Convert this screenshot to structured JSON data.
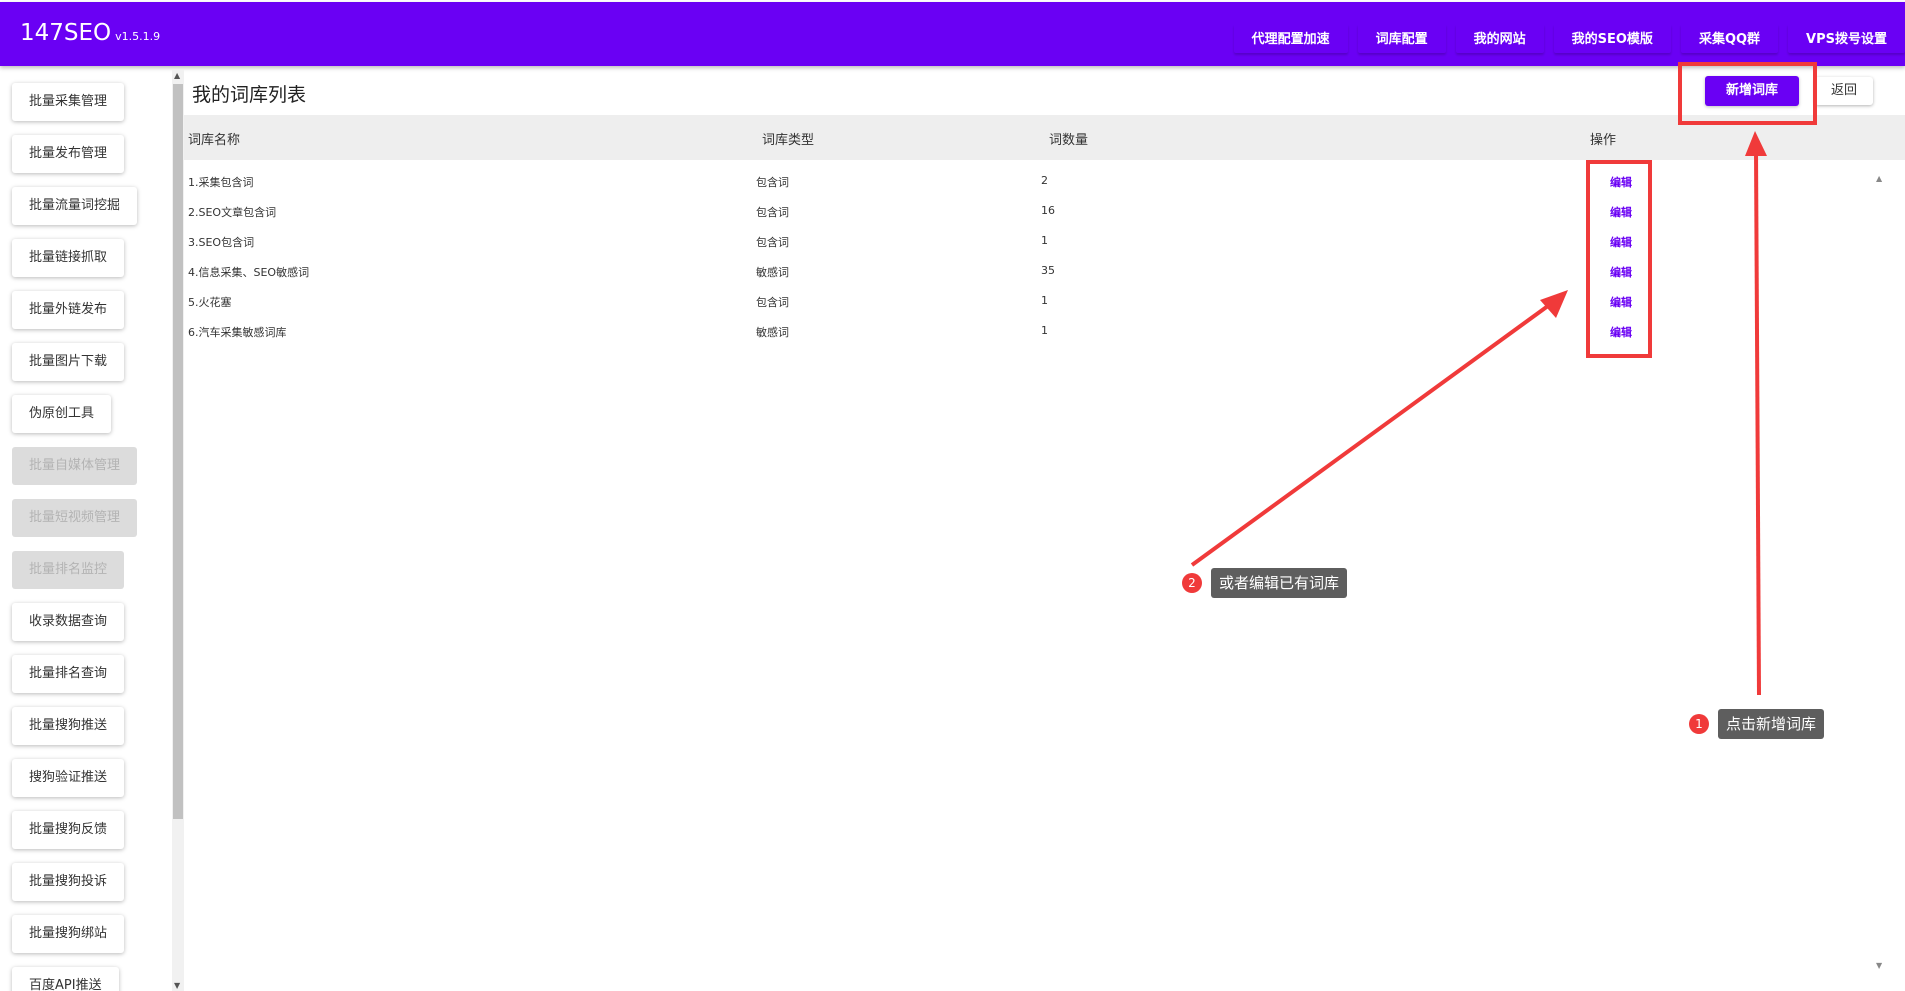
{
  "app": {
    "brand": "147SEO",
    "version": "v1.5.1.9"
  },
  "topnav": [
    "代理配置加速",
    "词库配置",
    "我的网站",
    "我的SEO模版",
    "采集QQ群",
    "VPS拨号设置"
  ],
  "sidebar": [
    {
      "label": "批量采集管理",
      "disabled": false
    },
    {
      "label": "批量发布管理",
      "disabled": false
    },
    {
      "label": "批量流量词挖掘",
      "disabled": false
    },
    {
      "label": "批量链接抓取",
      "disabled": false
    },
    {
      "label": "批量外链发布",
      "disabled": false
    },
    {
      "label": "批量图片下载",
      "disabled": false
    },
    {
      "label": "伪原创工具",
      "disabled": false
    },
    {
      "label": "批量自媒体管理",
      "disabled": true
    },
    {
      "label": "批量短视频管理",
      "disabled": true
    },
    {
      "label": "批量排名监控",
      "disabled": true
    },
    {
      "label": "收录数据查询",
      "disabled": false
    },
    {
      "label": "批量排名查询",
      "disabled": false
    },
    {
      "label": "批量搜狗推送",
      "disabled": false
    },
    {
      "label": "搜狗验证推送",
      "disabled": false
    },
    {
      "label": "批量搜狗反馈",
      "disabled": false
    },
    {
      "label": "批量搜狗投诉",
      "disabled": false
    },
    {
      "label": "批量搜狗绑站",
      "disabled": false
    },
    {
      "label": "百度API推送",
      "disabled": false
    }
  ],
  "page": {
    "title": "我的词库列表",
    "add_label": "新增词库",
    "back_label": "返回"
  },
  "table": {
    "headers": {
      "name": "词库名称",
      "type": "词库类型",
      "count": "词数量",
      "action": "操作"
    },
    "rows": [
      {
        "name": "1.采集包含词",
        "type": "包含词",
        "count": "2",
        "action": "编辑"
      },
      {
        "name": "2.SEO文章包含词",
        "type": "包含词",
        "count": "16",
        "action": "编辑"
      },
      {
        "name": "3.SEO包含词",
        "type": "包含词",
        "count": "1",
        "action": "编辑"
      },
      {
        "name": "4.信息采集、SEO敏感词",
        "type": "敏感词",
        "count": "35",
        "action": "编辑"
      },
      {
        "name": "5.火花塞",
        "type": "包含词",
        "count": "1",
        "action": "编辑"
      },
      {
        "name": "6.汽车采集敏感词库",
        "type": "敏感词",
        "count": "1",
        "action": "编辑"
      }
    ]
  },
  "annotations": {
    "callout1": {
      "number": "1",
      "text": "点击新增词库"
    },
    "callout2": {
      "number": "2",
      "text": "或者编辑已有词库"
    },
    "color": "#f03a3a"
  },
  "colors": {
    "brand": "#6a00f4",
    "annotation": "#f03a3a"
  }
}
